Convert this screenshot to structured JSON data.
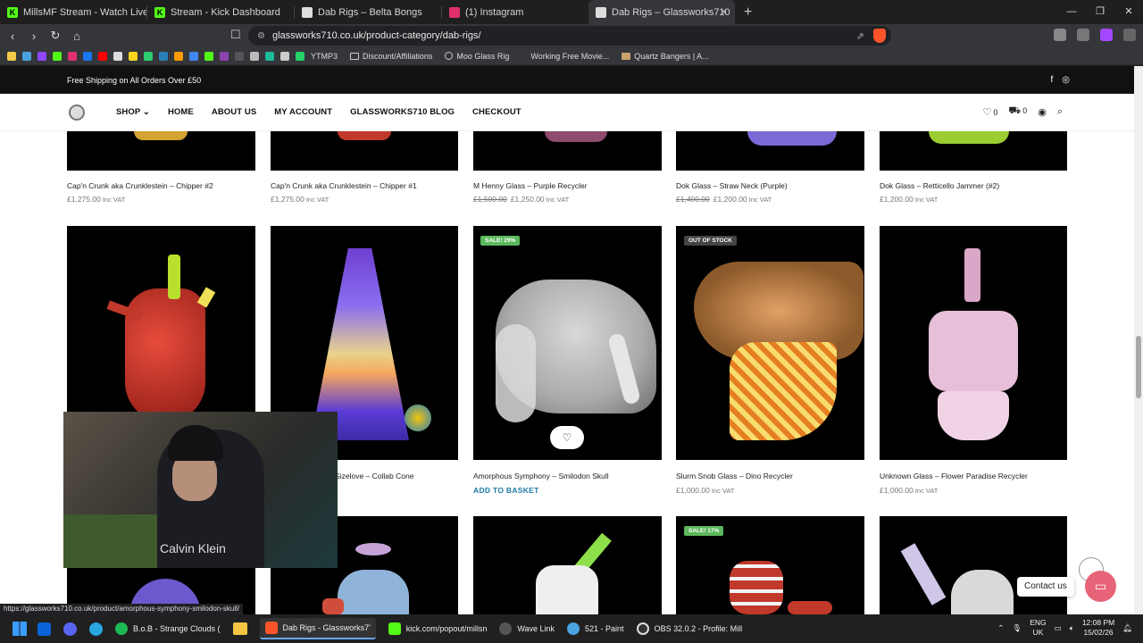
{
  "browser": {
    "tabs": [
      {
        "label": "MillsMF Stream - Watch Live on Kick",
        "icon": "kick-icon",
        "color": "#53fc18"
      },
      {
        "label": "Stream - Kick Dashboard",
        "icon": "kick-icon",
        "color": "#53fc18"
      },
      {
        "label": "Dab Rigs – Belta Bongs",
        "icon": "page-icon",
        "color": "#dddddd"
      },
      {
        "label": "(1) Instagram",
        "icon": "instagram-icon",
        "color": "#e1306c"
      },
      {
        "label": "Dab Rigs – Glassworks710",
        "icon": "page-icon",
        "color": "#dddddd"
      }
    ],
    "url": "glassworks710.co.uk/product-category/dab-rigs/",
    "bookmarks": [
      {
        "label": "YTMP3"
      },
      {
        "label": "Discount/Affiliations"
      },
      {
        "label": "Moo Glass Rig"
      },
      {
        "label": "Working Free Movie..."
      },
      {
        "label": "Quartz Bangers | A..."
      }
    ],
    "status_url": "https://glassworks710.co.uk/product/amorphous-symphony-smilodon-skull/"
  },
  "site": {
    "promo": "Free Shipping on All Orders Over £50",
    "menu": [
      "SHOP",
      "HOME",
      "ABOUT US",
      "MY ACCOUNT",
      "GLASSWORKS710 BLOG",
      "CHECKOUT"
    ],
    "wishlist_count": "0",
    "cart_count": "0"
  },
  "row1": [
    {
      "title": "Cap'n Crunk aka Crunklestein – Chipper #2",
      "old_price": "",
      "price": "£1,275.00",
      "vat": "Inc VAT"
    },
    {
      "title": "Cap'n Crunk aka Crunklestein – Chipper #1",
      "old_price": "",
      "price": "£1,275.00",
      "vat": "Inc VAT"
    },
    {
      "title": "M Henny Glass – Purple Recycler",
      "old_price": "£1,500.00",
      "price": "£1,250.00",
      "vat": "Inc VAT"
    },
    {
      "title": "Dok Glass – Straw Neck (Purple)",
      "old_price": "£1,400.00",
      "price": "£1,200.00",
      "vat": "Inc VAT"
    },
    {
      "title": "Dok Glass – Retticello Jammer (#2)",
      "old_price": "",
      "price": "£1,200.00",
      "vat": "Inc VAT"
    }
  ],
  "row2": [
    {
      "title": "",
      "badge": ""
    },
    {
      "title": "e Sizelove – Collab Cone",
      "badge": ""
    },
    {
      "title": "Amorphous Symphony – Smilodon Skull",
      "badge": "SALE! 29%",
      "action": "ADD TO BASKET"
    },
    {
      "title": "Slurm Snob Glass – Dino Recycler",
      "badge": "OUT OF STOCK",
      "price": "£1,000.00",
      "vat": "Inc VAT"
    },
    {
      "title": "Unknown Glass – Flower Paradise Recycler",
      "badge": "",
      "price": "£1,000.00",
      "vat": "Inc VAT"
    }
  ],
  "row3_badge": "SALE! 17%",
  "contact_label": "Contact us",
  "webcam_text": "Calvin Klein",
  "taskbar": [
    {
      "label": "B.o.B - Strange Clouds (",
      "color": "#1db954"
    },
    {
      "label": "Dab Rigs - Glassworks7'",
      "color": "#fb542b"
    },
    {
      "label": "kick.com/popout/millsn",
      "color": "#53fc18"
    },
    {
      "label": "Wave Link",
      "color": "#555555"
    },
    {
      "label": "521 - Paint",
      "color": "#4aa3df"
    },
    {
      "label": "OBS 32.0.2 - Profile: Mill",
      "color": "#333333"
    }
  ],
  "tray": {
    "lang1": "ENG",
    "lang2": "UK",
    "time": "12:08 PM",
    "date": "15/02/26"
  }
}
